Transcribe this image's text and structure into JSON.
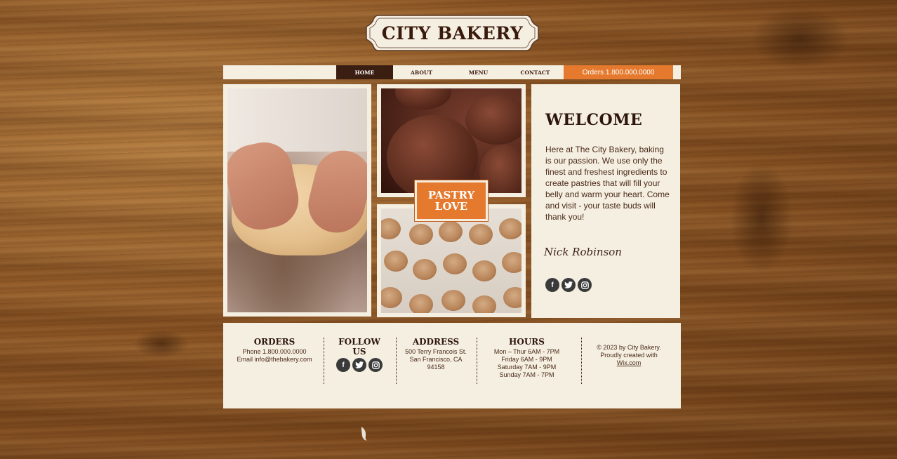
{
  "logo": {
    "title": "CITY BAKERY"
  },
  "nav": {
    "items": [
      {
        "label": "HOME",
        "active": true
      },
      {
        "label": "ABOUT",
        "active": false
      },
      {
        "label": "MENU",
        "active": false
      },
      {
        "label": "CONTACT",
        "active": false
      }
    ],
    "orders": "Orders 1.800.000.0000"
  },
  "badge": {
    "line1": "PASTRY",
    "line2": "LOVE"
  },
  "welcome": {
    "title": "WELCOME",
    "body": "Here at The City Bakery, baking is our passion. We use only the finest and freshest ingredients to create pastries that will fill your belly and warm your heart. Come and visit - your taste buds will thank you!",
    "signature": "Nick Robinson"
  },
  "social_icons": [
    "facebook-icon",
    "twitter-icon",
    "instagram-icon"
  ],
  "footer": {
    "orders": {
      "title": "ORDERS",
      "phone": "Phone 1.800.000.0000",
      "email": "Email info@thebakery.com"
    },
    "follow": {
      "title": "FOLLOW US"
    },
    "address": {
      "title": "ADDRESS",
      "line1": "500 Terry Francois St.",
      "line2": "San Francisco, CA",
      "line3": "94158"
    },
    "hours": {
      "title": "HOURS",
      "line1": "Mon – Thur  6AM - 7PM",
      "line2": "Friday  6AM - 9PM",
      "line3": "Saturday  7AM - 9PM",
      "line4": "Sunday  7AM - 7PM"
    },
    "copyright": {
      "line1": "© 2023 by City Bakery.",
      "line2": "Proudly created with",
      "link": "Wix.com"
    }
  },
  "colors": {
    "accent": "#e57a2e",
    "dark": "#3b1e12",
    "cream": "#f5efe2"
  }
}
